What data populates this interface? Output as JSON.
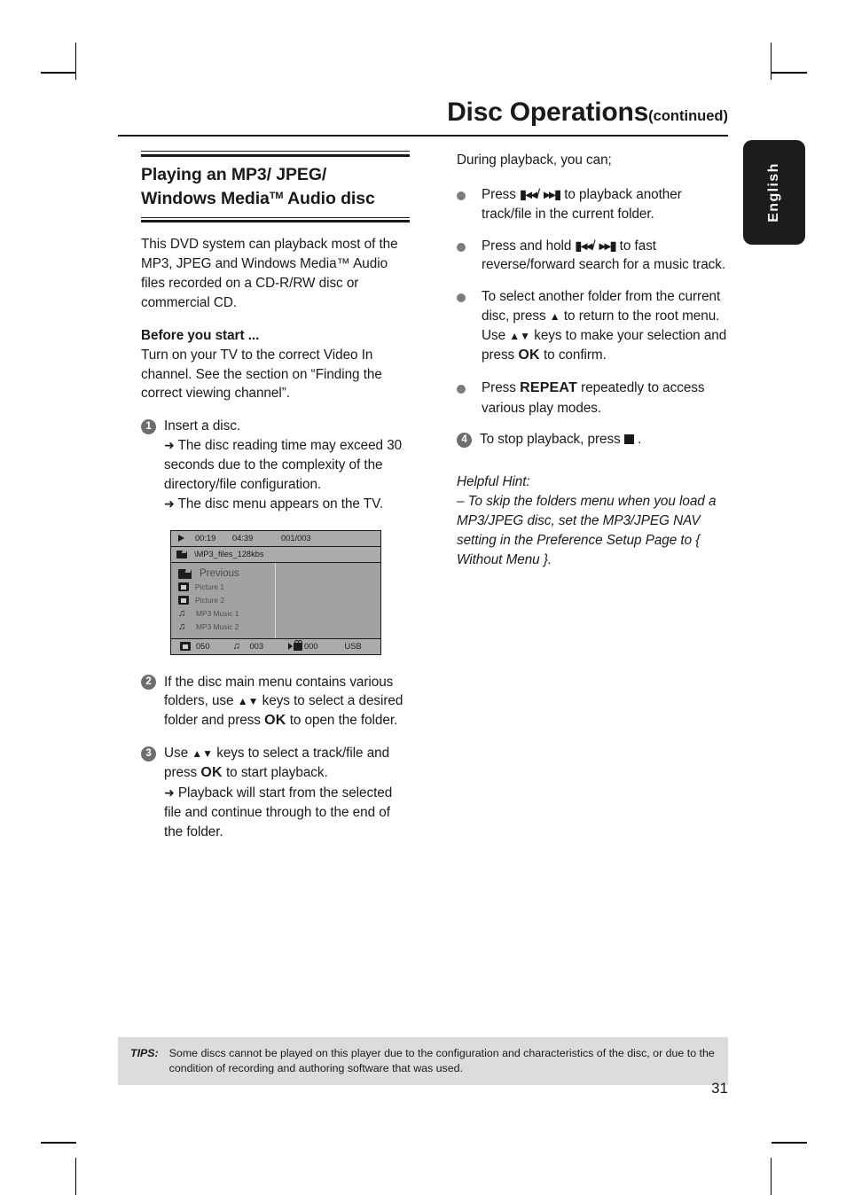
{
  "header": {
    "title": "Disc Operations",
    "continued": "(continued)"
  },
  "language_tab": {
    "label": "English"
  },
  "left_column": {
    "section_heading_line1": "Playing an MP3/ JPEG/",
    "section_heading_line2_a": "Windows Media",
    "section_heading_tm": "TM",
    "section_heading_line2_b": " Audio disc",
    "intro_paragraph": "This DVD system can playback most of the MP3, JPEG and Windows Media™ Audio files recorded on a CD-R/RW disc or commercial CD.",
    "before_you_start_heading": "Before you start ...",
    "before_you_start_text": "Turn on your TV to the correct Video In channel.  See the section on “Finding the correct viewing channel”.",
    "steps": [
      {
        "num": "1",
        "text": "Insert a disc.",
        "results": [
          "The disc reading time may exceed 30 seconds due to the complexity of the directory/file configuration.",
          "The disc menu appears on the TV."
        ]
      },
      {
        "num": "2",
        "text_a": "If the disc main menu contains various folders, use ",
        "keys": "▲▼",
        "text_b": " keys to select a desired folder and press ",
        "ok": "OK",
        "text_c": " to open the folder.",
        "results": []
      },
      {
        "num": "3",
        "text_a": "Use ",
        "keys": "▲▼",
        "text_b": " keys to select a track/file and press ",
        "ok": "OK",
        "text_c": " to start playback.",
        "results": [
          "Playback will start from the selected file and continue through to the end of the folder."
        ]
      }
    ]
  },
  "tv_screen": {
    "top_bar": {
      "play_icon": "play-triangle-icon",
      "elapsed_time": "00:19",
      "total_time": "04:39",
      "track_counter": "001/003"
    },
    "path_bar": {
      "folder_icon": "folder-open-icon",
      "path": "\\MP3_files_128kbs"
    },
    "file_list": [
      {
        "icon": "folder-open-icon",
        "label": "Previous"
      },
      {
        "icon": "picture-file-icon",
        "label": "Picture 1"
      },
      {
        "icon": "picture-file-icon",
        "label": "Picture 2"
      },
      {
        "icon": "music-note-icon",
        "label": "MP3 Music 1"
      },
      {
        "icon": "music-note-icon",
        "label": "MP3 Music 2"
      }
    ],
    "bottom_bar": {
      "picture_count": "050",
      "music_count": "003",
      "video_count": "000",
      "source": "USB"
    }
  },
  "right_column": {
    "intro": "During playback, you can;",
    "bullets": [
      {
        "text_a": "Press ",
        "icon_prev": "⏮",
        "sep": "/ ",
        "icon_next": "⏭",
        "text_b": " to playback another track/file in the current folder."
      },
      {
        "text_a": "Press and hold ",
        "icon_prev": "⏮",
        "sep": "/ ",
        "icon_next": "⏭",
        "text_b": " to fast reverse/forward search for a music track."
      },
      {
        "text_full_a": "To select another folder from the current disc, press ",
        "key_up": "▲",
        "text_full_b": " to return to the root menu.  Use ",
        "key_updown": "▲▼",
        "text_full_c": " keys to make your selection and press ",
        "ok": "OK",
        "text_full_d": " to confirm."
      },
      {
        "text_a": "Press ",
        "key_repeat": "REPEAT",
        "text_b": " repeatedly to access various play modes."
      }
    ],
    "step4": {
      "num": "4",
      "text_a": "To stop playback, press ",
      "stop_icon": "stop-square-icon",
      "text_b": " ."
    },
    "helpful_hint_title": "Helpful Hint:",
    "helpful_hint_body": "– To skip the folders menu when you load a MP3/JPEG disc, set the MP3/JPEG NAV setting in the Preference Setup Page to { Without Menu }."
  },
  "tips": {
    "label": "TIPS:",
    "text": "Some discs cannot be played on this player due to the configuration and characteristics of the disc, or due to the condition of recording and authoring software that was used."
  },
  "page_number": "31",
  "colors": {
    "text": "#1a1a1a",
    "bullet_gray": "#7b7b7b",
    "step_circle_gray": "#6e6e6e",
    "tips_bg": "#dcdcdc",
    "tab_black": "#1c1c1c",
    "tv_bar_gray": "#ababab",
    "tv_body_gray": "#a2a2a2"
  }
}
